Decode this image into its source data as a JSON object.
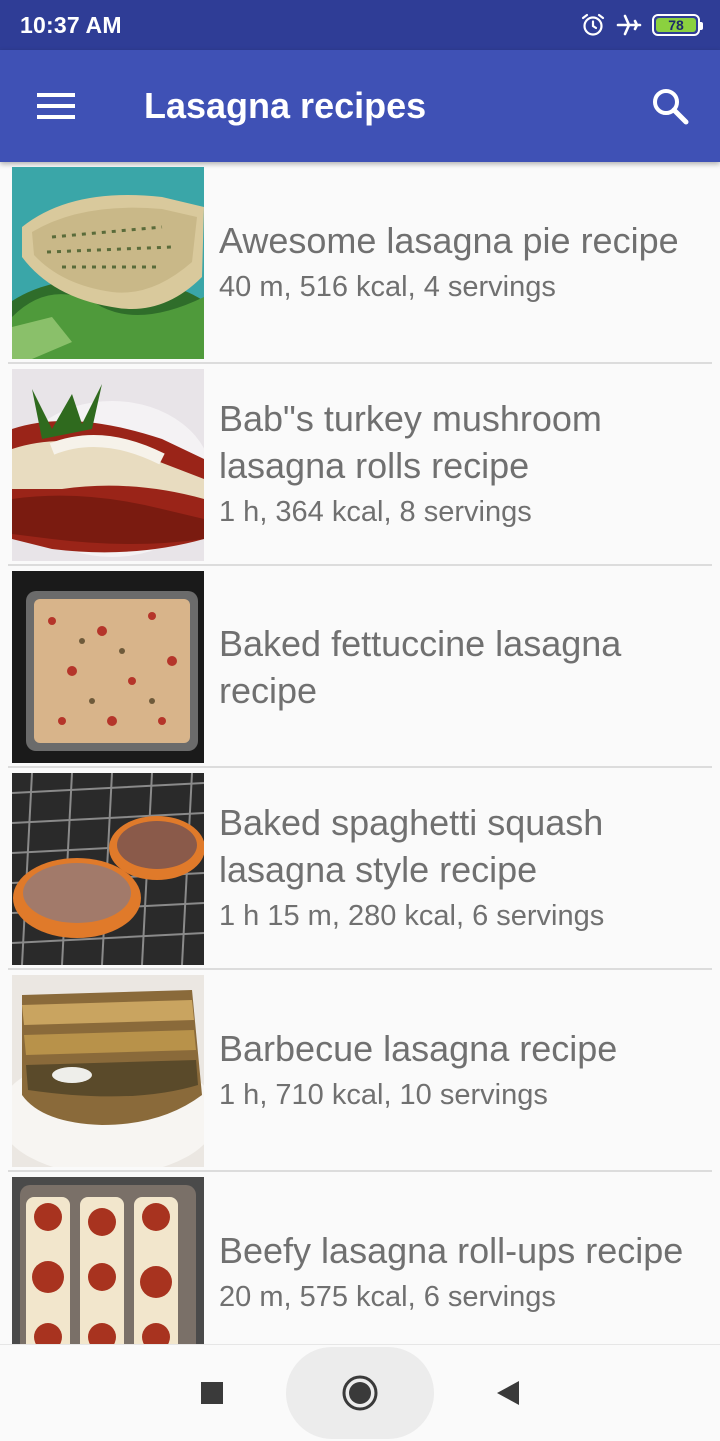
{
  "status_bar": {
    "time": "10:37 AM",
    "battery_level": "78",
    "icons": [
      "alarm-icon",
      "airplane-icon",
      "battery-icon"
    ]
  },
  "app_bar": {
    "title": "Lasagna recipes",
    "menu_icon": "hamburger-menu-icon",
    "search_icon": "search-icon",
    "color": "#3f51b5"
  },
  "recipes": [
    {
      "title": "Awesome lasagna pie recipe",
      "meta": "40 m, 516 kcal, 4 servings"
    },
    {
      "title": "Bab\"s turkey mushroom lasagna rolls recipe",
      "meta": "1 h, 364 kcal, 8 servings"
    },
    {
      "title": "Baked fettuccine lasagna recipe",
      "meta": ""
    },
    {
      "title": "Baked spaghetti squash lasagna style recipe",
      "meta": "1 h 15 m, 280 kcal, 6 servings"
    },
    {
      "title": "Barbecue lasagna recipe",
      "meta": "1 h, 710 kcal, 10 servings"
    },
    {
      "title": "Beefy lasagna roll-ups recipe",
      "meta": "20 m, 575 kcal, 6 servings"
    }
  ],
  "nav_bar": {
    "buttons": [
      "recents-square-icon",
      "home-circle-icon",
      "back-triangle-icon"
    ]
  }
}
